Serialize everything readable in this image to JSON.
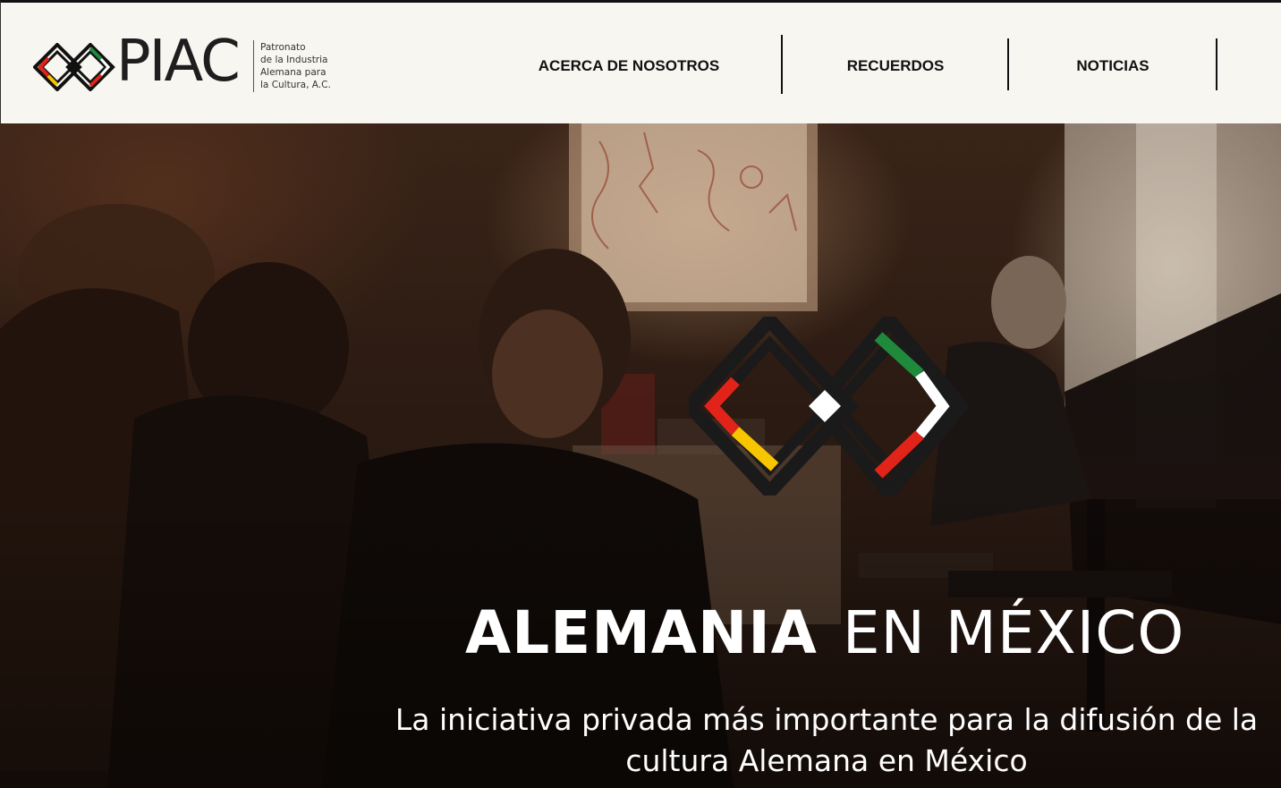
{
  "header": {
    "logo": {
      "wordmark": "PIAC",
      "tagline_lines": [
        "Patronato",
        "de la Industria",
        "Alemana para",
        "la Cultura, A.C."
      ]
    },
    "nav": [
      {
        "label": "ACERCA DE NOSOTROS"
      },
      {
        "label": "RECUERDOS"
      },
      {
        "label": "NOTICIAS"
      }
    ]
  },
  "hero": {
    "title_strong": "ALEMANIA",
    "title_light": "EN MÉXICO",
    "subtitle": "La iniciativa privada más importante para la difusión de la cultura Alemana en México",
    "emblem_icon": "piac-emblem-icon",
    "background": "photo-concert-pianist-audience"
  },
  "colors": {
    "header_bg": "#f8f6f1",
    "text_dark": "#111111",
    "germany_red": "#e2231a",
    "germany_gold": "#f7c600",
    "mexico_green": "#1f8a3c",
    "white": "#ffffff"
  }
}
